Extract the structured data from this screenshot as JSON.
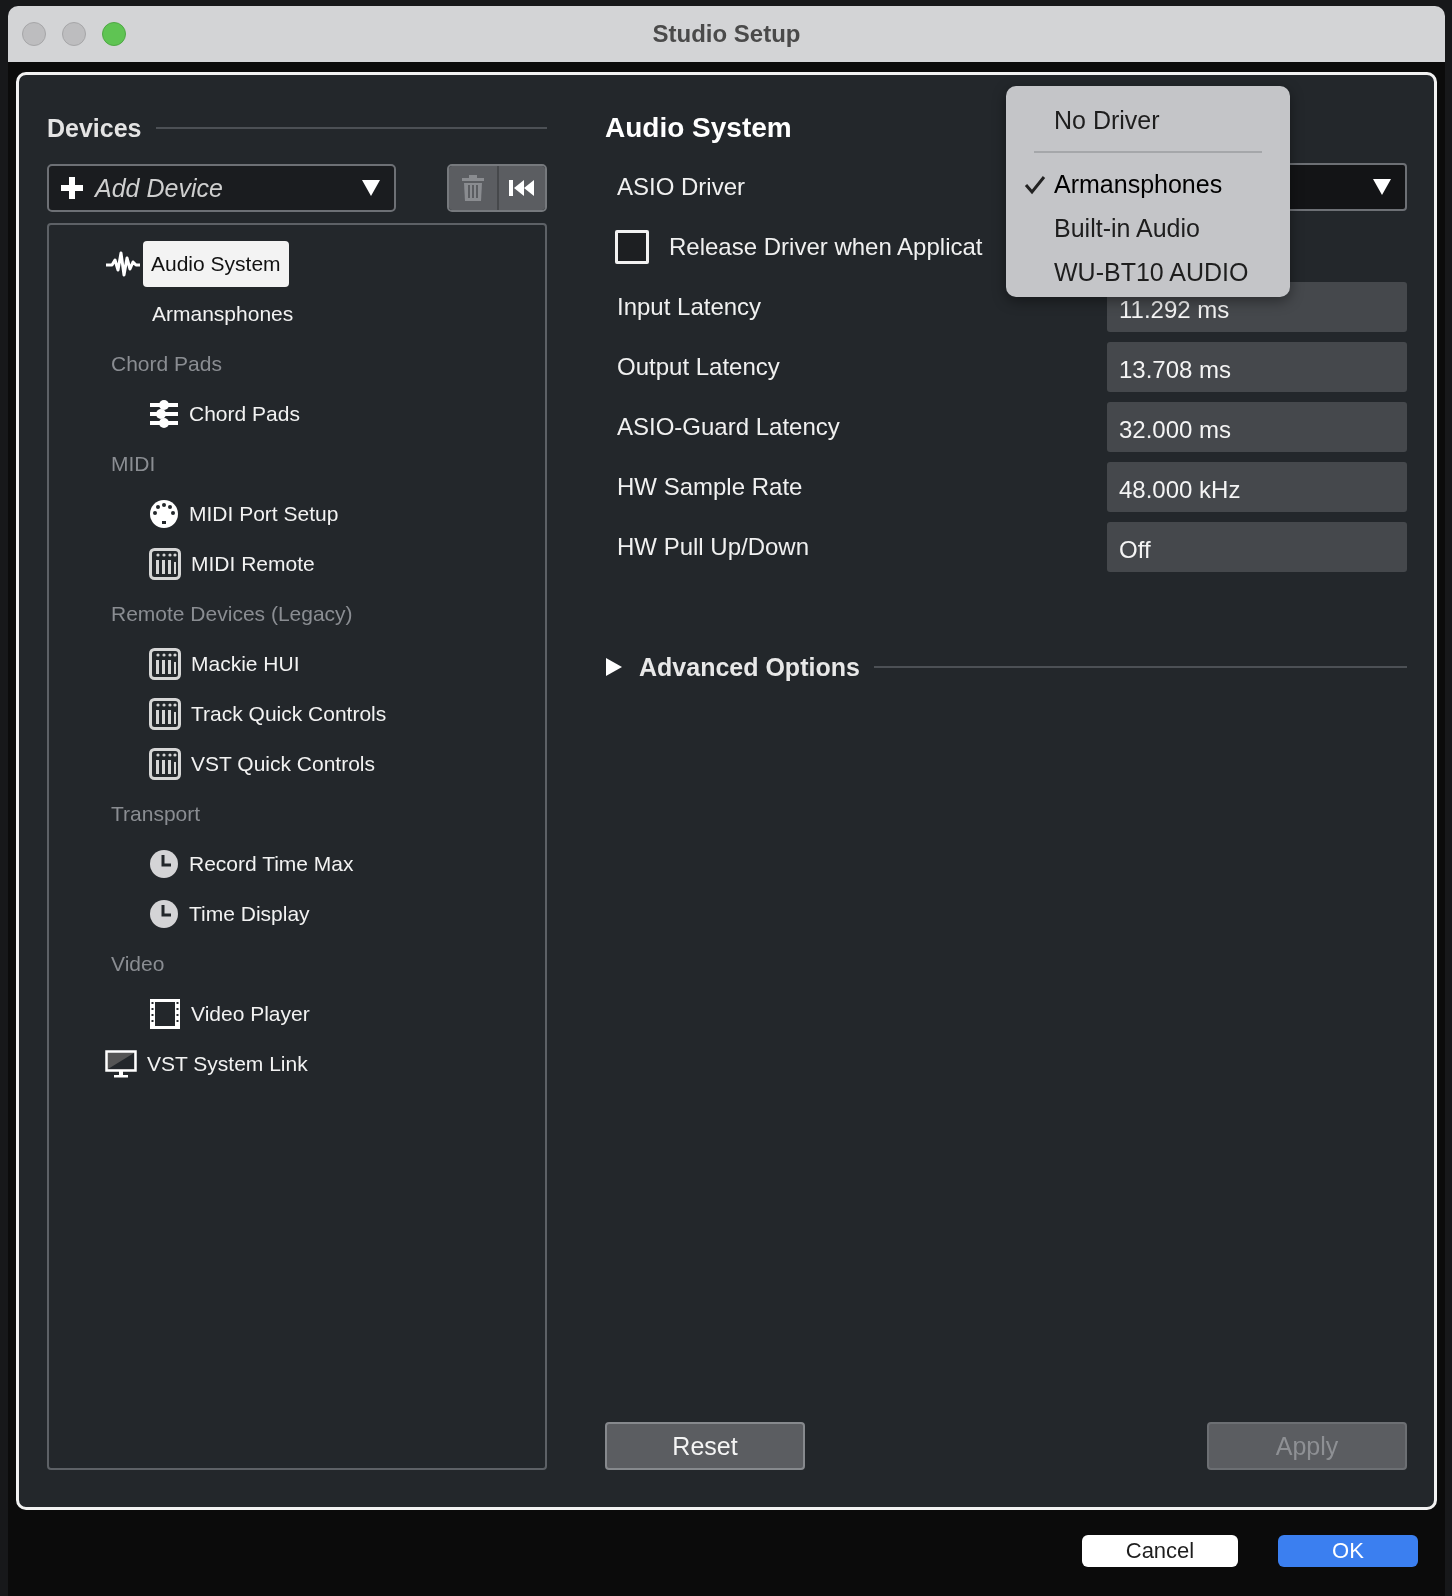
{
  "window": {
    "title": "Studio Setup"
  },
  "devices": {
    "title": "Devices",
    "add_device": {
      "label": "Add Device"
    },
    "tree": [
      {
        "kind": "audio",
        "label": "Audio System",
        "selected": true,
        "children": [
          {
            "kind": "driver",
            "label": "Armansphones",
            "selected": false
          }
        ]
      },
      {
        "kind": "category",
        "label": "Chord Pads",
        "children": [
          {
            "kind": "chord",
            "label": "Chord Pads",
            "selected": false
          }
        ]
      },
      {
        "kind": "category",
        "label": "MIDI",
        "children": [
          {
            "kind": "midi-port",
            "label": "MIDI Port Setup",
            "selected": false
          },
          {
            "kind": "remote",
            "label": "MIDI Remote",
            "selected": false
          }
        ]
      },
      {
        "kind": "category",
        "label": "Remote Devices (Legacy)",
        "children": [
          {
            "kind": "remote",
            "label": "Mackie HUI",
            "selected": false
          },
          {
            "kind": "remote",
            "label": "Track Quick Controls",
            "selected": false
          },
          {
            "kind": "remote",
            "label": "VST Quick Controls",
            "selected": false
          }
        ]
      },
      {
        "kind": "category",
        "label": "Transport",
        "children": [
          {
            "kind": "clock",
            "label": "Record Time Max",
            "selected": false
          },
          {
            "kind": "clock",
            "label": "Time Display",
            "selected": false
          }
        ]
      },
      {
        "kind": "category",
        "label": "Video",
        "children": [
          {
            "kind": "video",
            "label": "Video Player",
            "selected": false
          }
        ]
      },
      {
        "kind": "network",
        "label": "VST System Link",
        "selected": false
      }
    ]
  },
  "audio_system": {
    "title": "Audio System",
    "driver": {
      "label": "ASIO Driver"
    },
    "release_driver": {
      "label": "Release Driver when Applicat",
      "checked": false
    },
    "fields": [
      {
        "label": "Input Latency",
        "value": "11.292 ms"
      },
      {
        "label": "Output Latency",
        "value": "13.708 ms"
      },
      {
        "label": "ASIO-Guard Latency",
        "value": "32.000 ms"
      },
      {
        "label": "HW Sample Rate",
        "value": "48.000 kHz"
      },
      {
        "label": "HW Pull Up/Down",
        "value": "Off"
      }
    ],
    "advanced": {
      "label": "Advanced Options",
      "expanded": false
    },
    "buttons": [
      {
        "label": "Reset",
        "disabled": false
      },
      {
        "label": "Apply",
        "disabled": true
      }
    ]
  },
  "driver_menu": {
    "items": [
      {
        "kind": "item",
        "label": "No Driver",
        "selected": false
      },
      {
        "kind": "separator"
      },
      {
        "kind": "item",
        "label": "Armansphones",
        "selected": true
      },
      {
        "kind": "item",
        "label": "Built-in Audio",
        "selected": false
      },
      {
        "kind": "item",
        "label": "WU-BT10 AUDIO",
        "selected": false
      }
    ]
  },
  "dialog_buttons": [
    {
      "label": "Cancel",
      "kind": "default"
    },
    {
      "label": "OK",
      "kind": "primary"
    }
  ]
}
